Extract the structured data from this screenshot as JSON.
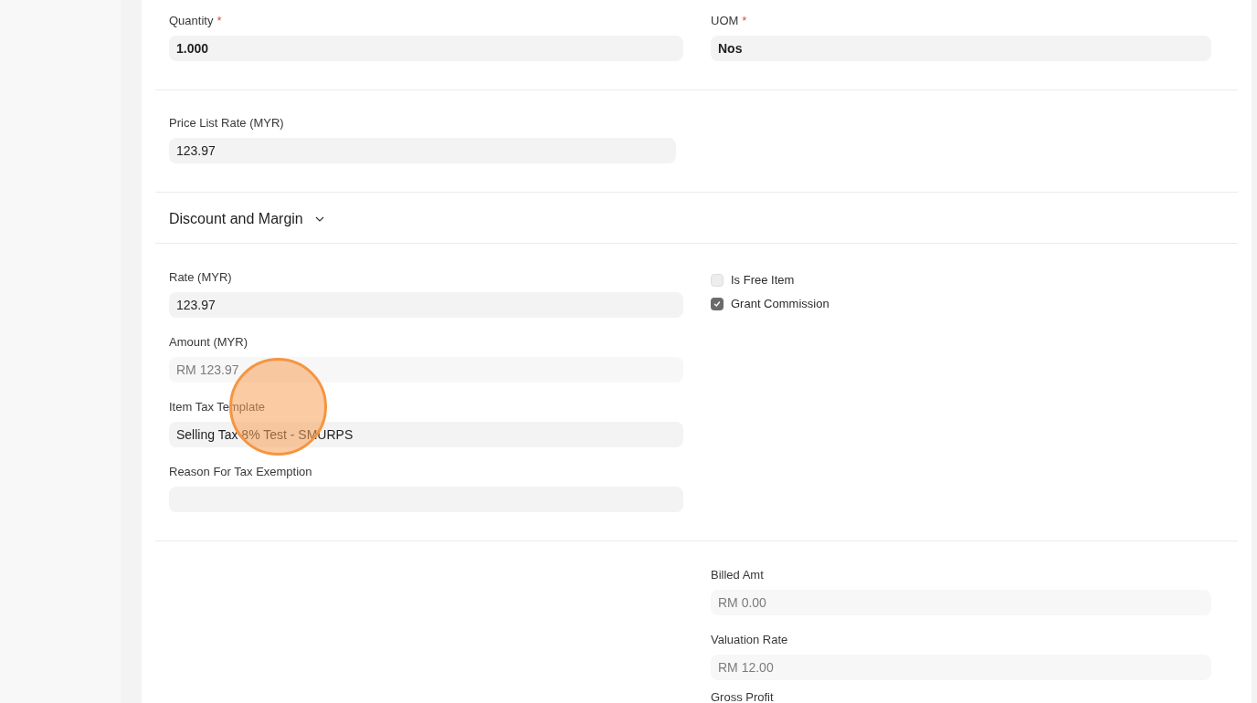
{
  "sections": [
    {
      "kind": "fields",
      "left": [
        {
          "label": "Quantity",
          "required_mark": "*",
          "value": "1.000",
          "emphasis": true,
          "read_only": false
        }
      ],
      "right": [
        {
          "kind": "field",
          "label": "UOM",
          "required_mark": "*",
          "value": "Nos",
          "emphasis": true,
          "read_only": false
        }
      ]
    },
    {
      "kind": "fields",
      "narrow": true,
      "left": [
        {
          "label": "Price List Rate (MYR)",
          "value": "123.97",
          "emphasis": false,
          "read_only": false
        }
      ]
    },
    {
      "kind": "heading",
      "title": "Discount and Margin",
      "expanded": true
    },
    {
      "kind": "fields",
      "left": [
        {
          "label": "Rate (MYR)",
          "value": "123.97",
          "emphasis": false,
          "read_only": false
        },
        {
          "label": "Amount (MYR)",
          "value": "RM 123.97",
          "emphasis": false,
          "read_only": true
        },
        {
          "label": "Item Tax Template",
          "value": "Selling Tax 8% Test - SMURPS",
          "emphasis": false,
          "read_only": false
        },
        {
          "label": "Reason For Tax Exemption"
        }
      ],
      "right": [
        {
          "kind": "checkbox",
          "label": "Is Free Item",
          "checked": false
        },
        {
          "kind": "checkbox",
          "label": "Grant Commission",
          "checked": true
        }
      ]
    },
    {
      "kind": "fields",
      "right": [
        {
          "kind": "field",
          "label": "Billed Amt",
          "value": "RM 0.00",
          "emphasis": false,
          "read_only": true
        },
        {
          "kind": "field",
          "label": "Valuation Rate",
          "value": "RM 12.00",
          "emphasis": false,
          "read_only": true
        },
        {
          "kind": "label",
          "label": "Gross Profit"
        }
      ]
    }
  ]
}
